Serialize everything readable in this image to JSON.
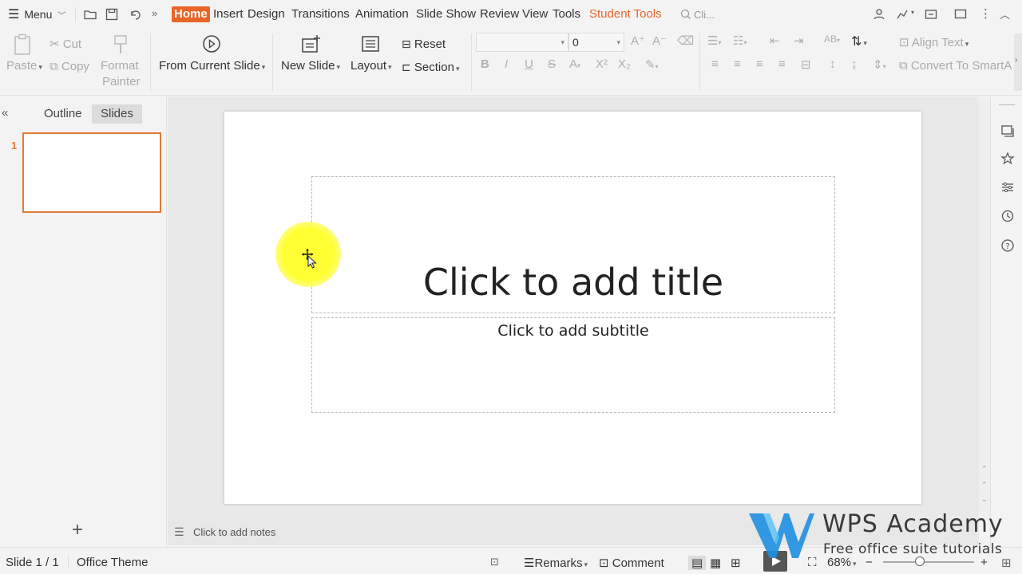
{
  "menubar": {
    "menu_label": "Menu",
    "tabs": [
      "Home",
      "Insert",
      "Design",
      "Transitions",
      "Animation",
      "Slide Show",
      "Review",
      "View",
      "Tools",
      "Student Tools"
    ],
    "search_placeholder": "Cli..."
  },
  "ribbon": {
    "paste": "Paste",
    "cut": "Cut",
    "copy": "Copy",
    "format_painter_1": "Format",
    "format_painter_2": "Painter",
    "from_current_slide": "From Current Slide",
    "new_slide": "New Slide",
    "layout": "Layout",
    "reset": "Reset",
    "section": "Section",
    "font_name": "",
    "font_size": "0",
    "align_text": "Align Text",
    "convert_to_smartart": "Convert To SmartA"
  },
  "leftpanel": {
    "tab_outline": "Outline",
    "tab_slides": "Slides",
    "slide_number": "1",
    "add_slide": "+"
  },
  "slide": {
    "title_placeholder": "Click to add title",
    "subtitle_placeholder": "Click to add subtitle"
  },
  "notes": {
    "placeholder": "Click to add notes"
  },
  "statusbar": {
    "slide_counter": "Slide 1 / 1",
    "theme": "Office Theme",
    "remarks": "Remarks",
    "comment": "Comment",
    "zoom": "68%"
  },
  "watermark": {
    "title": "WPS Academy",
    "subtitle": "Free office suite tutorials"
  },
  "colors": {
    "accent": "#e8652a",
    "thumb_border": "#e07b3c",
    "cursor_highlight": "#ffff33"
  }
}
